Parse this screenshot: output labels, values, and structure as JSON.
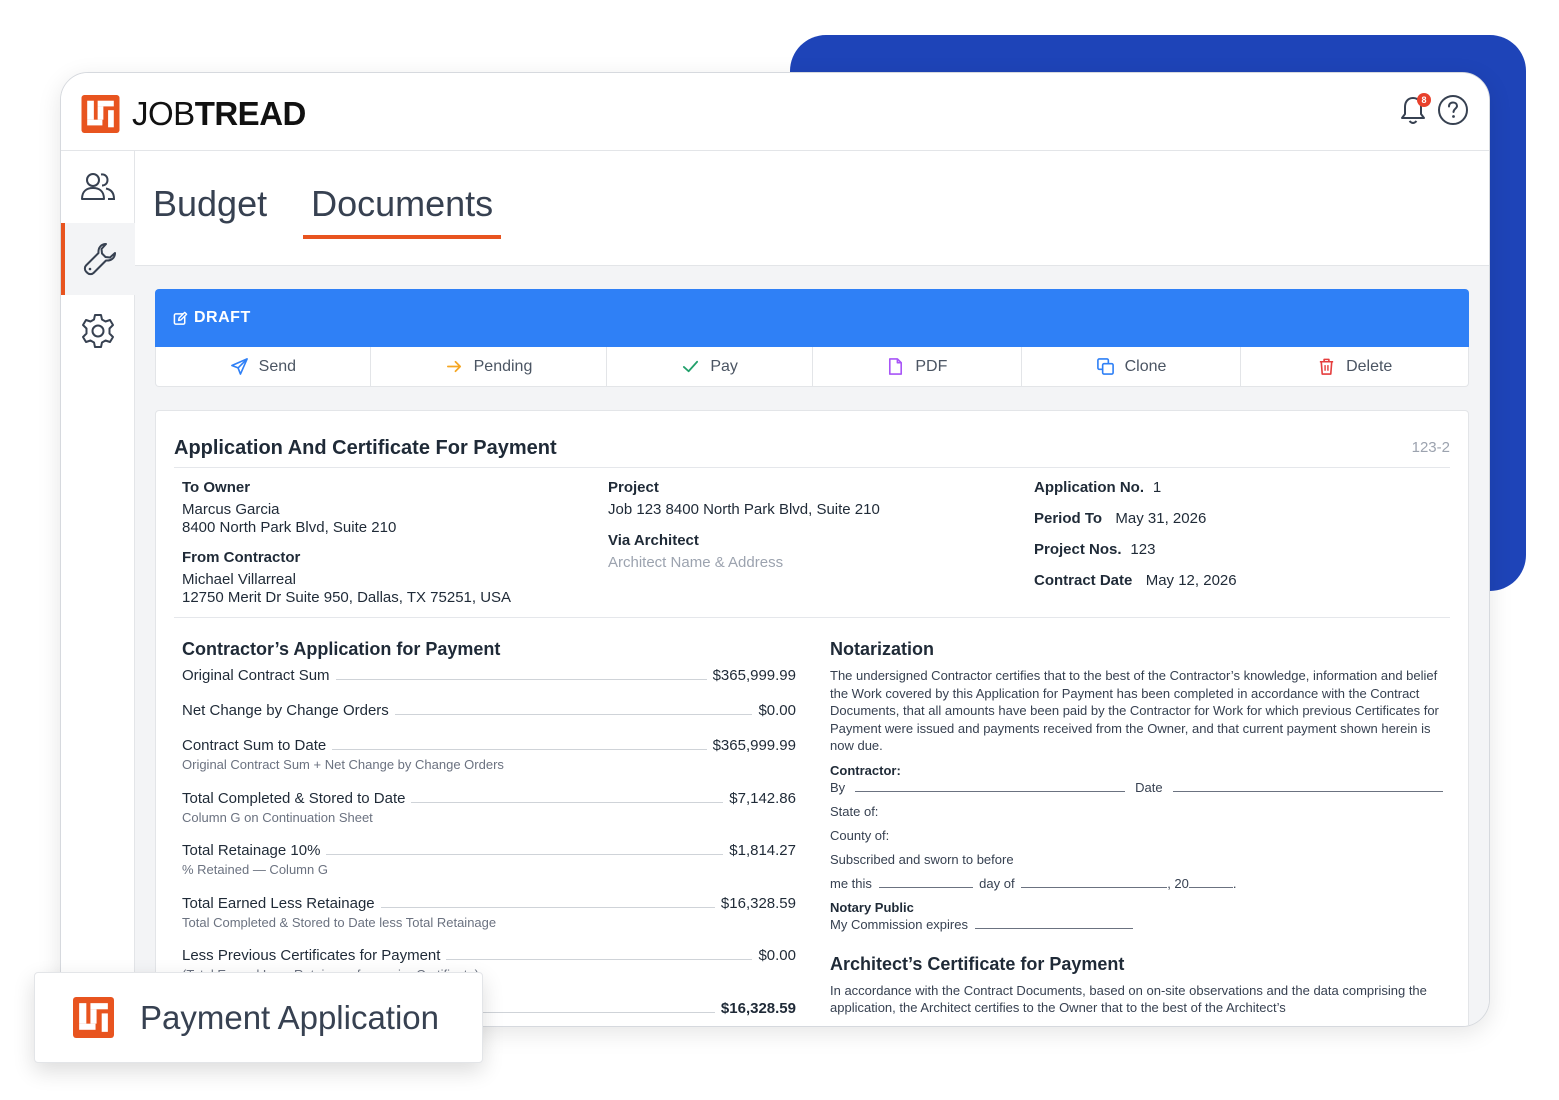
{
  "brand": {
    "name_light": "JOB",
    "name_bold": "TREAD",
    "accent": "#e8541f",
    "backdrop": "#1e44b8",
    "draft_blue": "#2f80f6"
  },
  "header": {
    "notification_count": "8",
    "icons": [
      "bell-icon",
      "help-icon"
    ]
  },
  "sidebar": {
    "items": [
      {
        "name": "users",
        "icon": "users-icon",
        "active": false
      },
      {
        "name": "tools",
        "icon": "wrench-icon",
        "active": true
      },
      {
        "name": "settings",
        "icon": "gear-icon",
        "active": false
      }
    ]
  },
  "tabs": [
    {
      "label": "Budget",
      "active": false
    },
    {
      "label": "Documents",
      "active": true
    }
  ],
  "status": {
    "label": "DRAFT"
  },
  "actions": [
    {
      "label": "Send",
      "icon": "send-icon",
      "color": "#2f80f6"
    },
    {
      "label": "Pending",
      "icon": "arrow-right-icon",
      "color": "#f5a623"
    },
    {
      "label": "Pay",
      "icon": "check-icon",
      "color": "#22a06b"
    },
    {
      "label": "PDF",
      "icon": "file-icon",
      "color": "#a855f7"
    },
    {
      "label": "Clone",
      "icon": "clone-icon",
      "color": "#2f80f6"
    },
    {
      "label": "Delete",
      "icon": "trash-icon",
      "color": "#e53e3e"
    }
  ],
  "document": {
    "title": "Application And Certificate For Payment",
    "id": "123-2",
    "to_owner": {
      "label": "To Owner",
      "name": "Marcus Garcia",
      "address": "8400 North Park Blvd, Suite 210"
    },
    "from_contractor": {
      "label": "From Contractor",
      "name": "Michael Villarreal",
      "address": "12750 Merit Dr Suite 950, Dallas, TX 75251, USA"
    },
    "project": {
      "label": "Project",
      "value": "Job 123 8400 North Park Blvd, Suite 210"
    },
    "via_architect": {
      "label": "Via Architect",
      "placeholder": "Architect Name & Address"
    },
    "meta": {
      "application_no_label": "Application No.",
      "application_no": "1",
      "period_to_label": "Period To",
      "period_to": "May 31, 2026",
      "project_nos_label": "Project Nos.",
      "project_nos": "123",
      "contract_date_label": "Contract Date",
      "contract_date": "May 12, 2026"
    },
    "application": {
      "heading": "Contractor’s Application for Payment",
      "rows": [
        {
          "label": "Original Contract Sum",
          "value": "$365,999.99",
          "sub": ""
        },
        {
          "label": "Net Change by Change Orders",
          "value": "$0.00",
          "sub": ""
        },
        {
          "label": "Contract Sum to Date",
          "value": "$365,999.99",
          "sub": "Original Contract Sum + Net Change by Change Orders"
        },
        {
          "label": "Total Completed & Stored to Date",
          "value": "$7,142.86",
          "sub": "Column G on Continuation Sheet"
        },
        {
          "label": "Total Retainage 10%",
          "value": "$1,814.27",
          "sub": "% Retained — Column G"
        },
        {
          "label": "Total Earned Less Retainage",
          "value": "$16,328.59",
          "sub": "Total Completed & Stored to Date less Total Retainage"
        },
        {
          "label": "Less Previous Certificates for Payment",
          "value": "$0.00",
          "sub": "(Total Earned Less Retainage from prior Certificate)"
        },
        {
          "label": "",
          "value": "$16,328.59",
          "sub": ""
        }
      ]
    },
    "notarization": {
      "heading": "Notarization",
      "body": "The undersigned Contractor certifies that to the best of the Contractor’s knowledge, information and belief the Work covered by this Application for Payment has been completed in accordance with the Contract Documents, that all amounts have been paid by the Contractor for Work for which previous Certificates for Payment were issued and payments received from the Owner, and that current payment shown herein is now due.",
      "contractor_label": "Contractor:",
      "by_label": "By",
      "date_label": "Date",
      "state_label": "State of:",
      "county_label": "County of:",
      "subscribed_label": "Subscribed and sworn to before",
      "me_this_label": "me this",
      "day_of_label": "day of",
      "year_label": ", 20",
      "year_end": ".",
      "notary_label": "Notary Public",
      "commission_label": "My Commission expires"
    },
    "architect": {
      "heading": "Architect’s Certificate for Payment",
      "body": "In accordance with the Contract Documents, based on on-site observations and the data comprising the application, the Architect certifies to the Owner that to the best of the Architect’s"
    }
  },
  "feature_card": {
    "label": "Payment Application"
  }
}
